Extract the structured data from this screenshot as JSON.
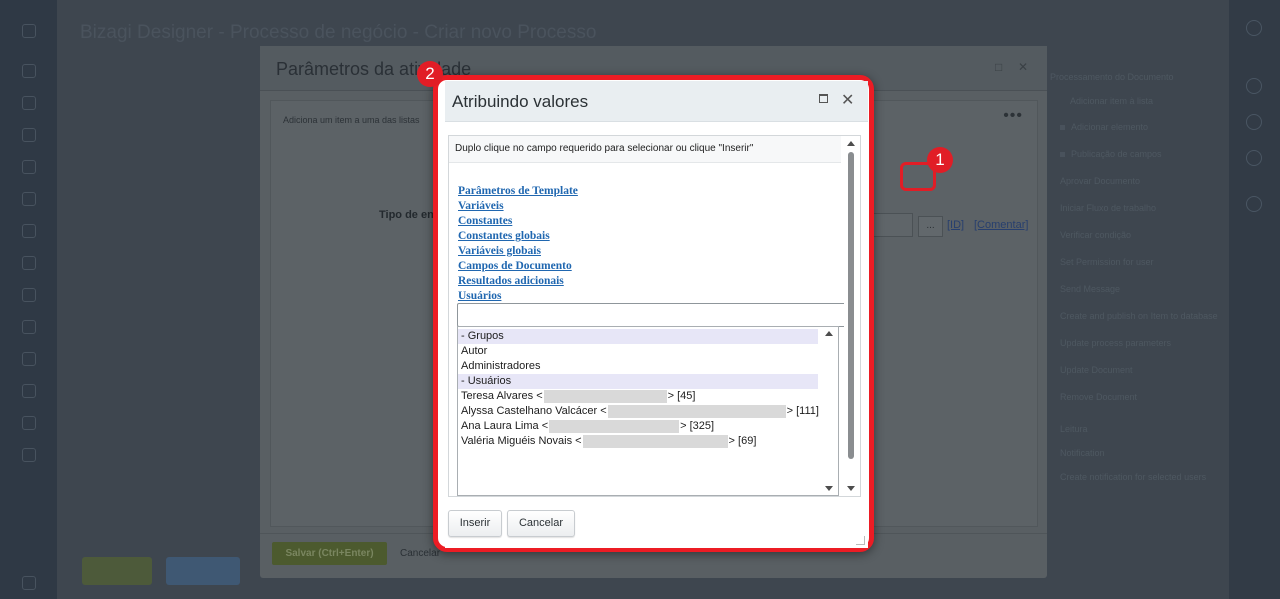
{
  "background": {
    "app_title": "Bizagi Designer - Processo de negócio - Criar novo Processo",
    "params_modal": {
      "title": "Parâmetros da atividade",
      "description": "Adiciona um item a uma das listas",
      "field_label": "Tipo de en",
      "dots_button": "...",
      "link_id": "[ID]",
      "link_comment": "[Comentar]",
      "save_button": "Salvar (Ctrl+Enter)",
      "cancel_button": "Cancelar",
      "more": "•••"
    },
    "right_panel": {
      "items": [
        "Processamento do Documento",
        "Adicionar item à lista",
        "Adicionar elemento",
        "Publicação de campos",
        "Aprovar Documento",
        "Iniciar Fluxo de trabalho",
        "Verificar condição",
        "Set Permission for user",
        "Send Message",
        "Create and publish on Item to database",
        "Update process parameters",
        "Update Document",
        "Remove Document",
        "Leitura",
        "Notification",
        "Create notification for selected users"
      ]
    }
  },
  "markers": {
    "m1": "1",
    "m2": "2"
  },
  "dialog": {
    "title": "Atribuindo valores",
    "hint": "Duplo clique no campo requerido para selecionar ou clique \"Inserir\"",
    "categories": [
      "Parâmetros de Template",
      "Variáveis",
      "Constantes",
      "Constantes globais",
      "Variáveis globais",
      "Campos de Documento",
      "Resultados adicionais",
      "Usuários"
    ],
    "search_value": "",
    "list_items": [
      {
        "label": "- Grupos"
      },
      {
        "label": "Autor"
      },
      {
        "label": "Administradores"
      },
      {
        "label": "- Usuários"
      },
      {
        "label": "Teresa Alvares <",
        "suffix": "> [45]"
      },
      {
        "label": "Alyssa Castelhano Valcácer <",
        "suffix": "> [111]"
      },
      {
        "label": "Ana Laura Lima <",
        "suffix": "> [325]"
      },
      {
        "label": "Valéria Miguéis Novais <",
        "suffix": "> [69]"
      }
    ],
    "insert_button": "Inserir",
    "cancel_button": "Cancelar"
  },
  "colors": {
    "marker_red": "#e11d26",
    "link_blue": "#2067b0",
    "group_highlight": "#e7e6f7"
  }
}
